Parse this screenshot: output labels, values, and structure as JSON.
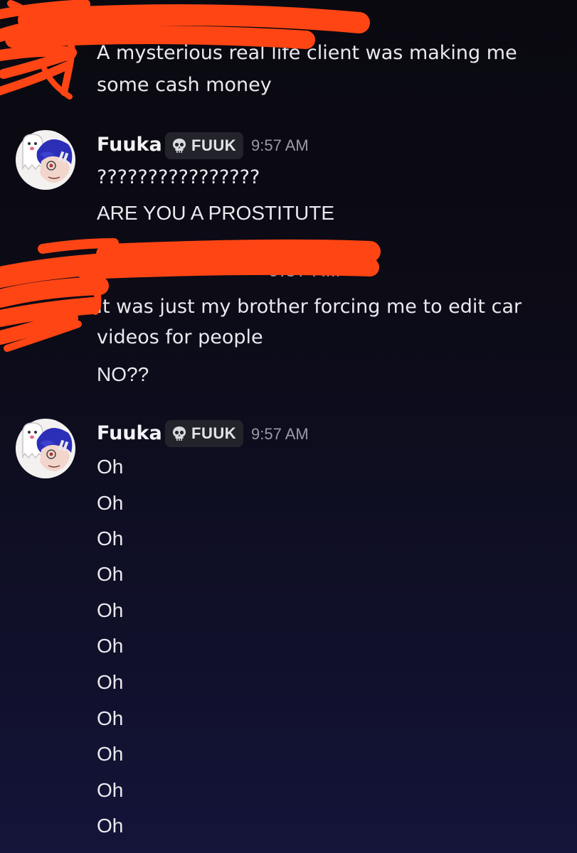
{
  "messages": [
    {
      "id": "m1",
      "author_redacted": true,
      "lines": [
        "A mysterious real life client was making me",
        "some cash money"
      ]
    },
    {
      "id": "m2",
      "author": "Fuuka",
      "tag": "FUUK",
      "time": "9:57 AM",
      "lines": [
        "????????????????",
        "ARE YOU A PROSTITUTE"
      ]
    },
    {
      "id": "m3",
      "author_redacted": true,
      "time_fragment": "9:57 AM",
      "lines": [
        "It was just my brother forcing me to edit car",
        "videos for people",
        "NO??"
      ]
    },
    {
      "id": "m4",
      "author": "Fuuka",
      "tag": "FUUK",
      "time": "9:57 AM",
      "lines": [
        "Oh",
        "Oh",
        "Oh",
        "Oh",
        "Oh",
        "Oh",
        "Oh",
        "Oh",
        "Oh",
        "Oh",
        "Oh"
      ]
    }
  ],
  "colors": {
    "background_top": "#0a0910",
    "background_bottom": "#14143a",
    "redaction": "#ff4514",
    "tag_background": "#23232b",
    "timestamp": "#9a9aa6"
  },
  "icons": {
    "tag_icon": "skull-icon",
    "avatar": "anime-avatar-with-ghost"
  }
}
